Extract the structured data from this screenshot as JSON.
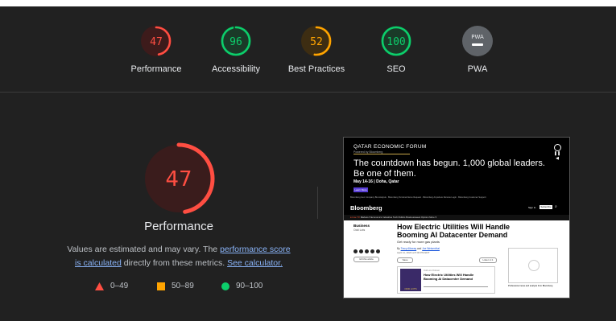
{
  "scores": [
    {
      "label": "Performance",
      "value": "47",
      "color": "#ff4e42",
      "track": "#3d1b1b",
      "fraction": 0.47
    },
    {
      "label": "Accessibility",
      "value": "96",
      "color": "#0cce6b",
      "track": "#1a3a28",
      "fraction": 0.96
    },
    {
      "label": "Best Practices",
      "value": "52",
      "color": "#ffa400",
      "track": "#3d2d12",
      "fraction": 0.52
    },
    {
      "label": "SEO",
      "value": "100",
      "color": "#0cce6b",
      "track": "#1a3a28",
      "fraction": 1.0
    },
    {
      "label": "PWA",
      "value": "PWA",
      "color": "#9aa0a6",
      "track": "#5f6368",
      "fraction": 0
    }
  ],
  "main": {
    "score": "47",
    "fraction": 0.47,
    "color": "#ff4e42",
    "title": "Performance",
    "note_part1": "Values are estimated and may vary. The ",
    "link1": "performance score is calculated",
    "note_part2": " directly from these metrics. ",
    "link2": "See calculator."
  },
  "legend": [
    {
      "shape": "triangle",
      "color": "#ff4e42",
      "range": "0–49"
    },
    {
      "shape": "square",
      "color": "#ffa400",
      "range": "50–89"
    },
    {
      "shape": "circle",
      "color": "#0cce6b",
      "range": "90–100"
    }
  ],
  "thumbnail": {
    "ad_title": "QATAR ECONOMIC FORUM",
    "ad_powered": "Powered by Bloomberg",
    "ad_headline": "The countdown has begun. 1,000 global leaders. Be one of them.",
    "ad_date": "May 14-16 | Doha, Qatar",
    "ad_button": "Learn More",
    "links": "Bloomberg Gen Company Bio Analysis  ·  Bloomberg Terminal Demo Request  ·  Bloomberg Anywhere Remote Login  ·  Bloomberg Customer Support",
    "logo": "Bloomberg",
    "sign_in": "Sign In",
    "subscribe": "Subscribe",
    "nav_live": "● Live TV",
    "nav": "Markets ▾  Economics  Industries  Tech  Politics  Businessweek  Opinion  More ▾",
    "section": "Business",
    "section2": "Odd Lots",
    "headline": "How Electric Utilities Will Handle Booming AI Datacenter Demand",
    "dek": "Get ready for more gas plants",
    "byline_prefix": "By ",
    "author1": "Tracy Alloway",
    "byline_mid": " and ",
    "author2": "Joe Weisenthal",
    "date": "April 11, 2024 at 5:00 PM EDT",
    "save": "Save",
    "listen": "Listen 1:1",
    "gift": "Gift this article",
    "podcast": "Odd Lots Podcast",
    "podcast_title": "How Electric Utilities Will Handle Booming AI Datacenter Demand",
    "art_label": "ODD LOTS",
    "side_caption": "Professional news and analysis from Bloomberg"
  }
}
